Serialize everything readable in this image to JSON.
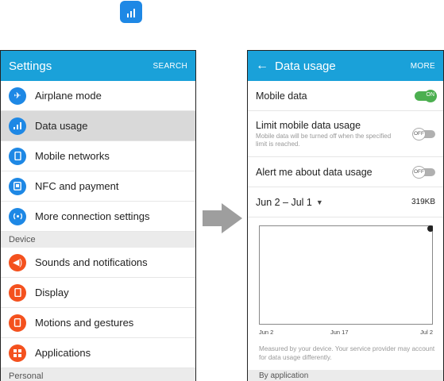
{
  "colors": {
    "appbar": "#1aa1d9",
    "toggle_on": "#4caf50",
    "blue_icon": "#1e88e5",
    "orange_icon": "#f4511e"
  },
  "top_icon": {
    "name": "data-usage-app-icon"
  },
  "settings": {
    "title": "Settings",
    "search": "SEARCH",
    "items": [
      {
        "label": "Airplane mode",
        "icon": "airplane-icon"
      },
      {
        "label": "Data usage",
        "icon": "data-usage-icon"
      },
      {
        "label": "Mobile networks",
        "icon": "mobile-networks-icon"
      },
      {
        "label": "NFC and payment",
        "icon": "nfc-icon"
      },
      {
        "label": "More connection settings",
        "icon": "connection-icon"
      }
    ],
    "section_device": "Device",
    "device_items": [
      {
        "label": "Sounds and notifications",
        "icon": "sound-icon"
      },
      {
        "label": "Display",
        "icon": "display-icon"
      },
      {
        "label": "Motions and gestures",
        "icon": "motion-icon"
      },
      {
        "label": "Applications",
        "icon": "applications-icon"
      }
    ],
    "section_personal": "Personal"
  },
  "data_usage": {
    "title": "Data usage",
    "more": "MORE",
    "mobile_data": {
      "label": "Mobile data",
      "state": "ON"
    },
    "limit": {
      "label": "Limit mobile data usage",
      "sub": "Mobile data will be turned off when the specified limit is reached.",
      "state": "OFF"
    },
    "alert": {
      "label": "Alert me about data usage",
      "state": "OFF"
    },
    "period": {
      "label": "Jun 2 – Jul 1",
      "amount": "319KB"
    },
    "chart_labels": [
      "Jun 2",
      "Jun 17",
      "Jul 2"
    ],
    "note": "Measured by your device. Your service provider may account for data usage differently.",
    "by_application": "By application"
  }
}
